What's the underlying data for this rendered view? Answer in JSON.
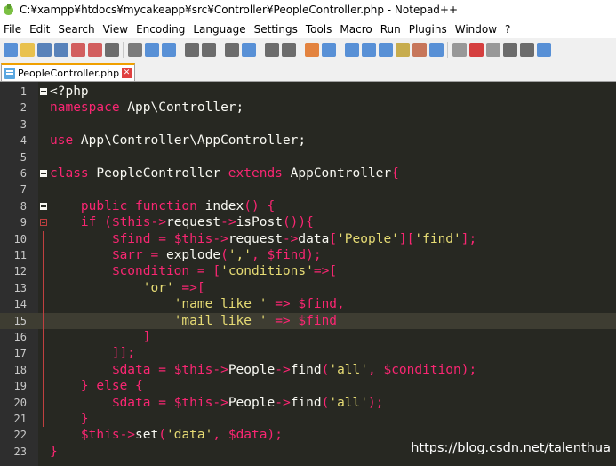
{
  "window": {
    "title": "C:¥xampp¥htdocs¥mycakeapp¥src¥Controller¥PeopleController.php - Notepad++"
  },
  "menu": [
    "File",
    "Edit",
    "Search",
    "View",
    "Encoding",
    "Language",
    "Settings",
    "Tools",
    "Macro",
    "Run",
    "Plugins",
    "Window",
    "?"
  ],
  "toolbar": {
    "icons": [
      "new-file-icon",
      "open-file-icon",
      "save-icon",
      "save-all-icon",
      "close-icon",
      "close-all-icon",
      "print-icon",
      "cut-icon",
      "copy-icon",
      "paste-icon",
      "undo-icon",
      "redo-icon",
      "find-icon",
      "replace-icon",
      "zoom-in-icon",
      "zoom-out-icon",
      "sync-v-icon",
      "sync-h-icon",
      "word-wrap-icon",
      "show-all-chars-icon",
      "indent-guide-icon",
      "doc-map-icon",
      "function-list-icon",
      "folder-workspace-icon",
      "monitoring-icon",
      "record-macro-icon",
      "stop-record-icon",
      "play-macro-icon",
      "run-macro-multiple-icon",
      "save-macro-icon"
    ]
  },
  "tab": {
    "label": "PeopleController.php"
  },
  "colors": {
    "background": "#272822",
    "keyword": "#f92672",
    "string": "#e6db74",
    "default": "#f8f8f2",
    "gutter": "#2e2e2e",
    "fold_red": "#c04040"
  },
  "editor": {
    "current_line": 15,
    "lines": [
      {
        "n": "1",
        "tokens": [
          [
            "op",
            "<?php"
          ]
        ]
      },
      {
        "n": "2",
        "tokens": [
          [
            "kw",
            "namespace"
          ],
          [
            "va",
            " App\\Controller;"
          ]
        ]
      },
      {
        "n": "3",
        "tokens": []
      },
      {
        "n": "4",
        "tokens": [
          [
            "kw",
            "use"
          ],
          [
            "va",
            " App\\Controller\\AppController;"
          ]
        ]
      },
      {
        "n": "5",
        "tokens": []
      },
      {
        "n": "6",
        "tokens": [
          [
            "kw",
            "class"
          ],
          [
            "va",
            " PeopleController "
          ],
          [
            "kw",
            "extends"
          ],
          [
            "va",
            " AppController"
          ],
          [
            "kw",
            "{"
          ]
        ]
      },
      {
        "n": "7",
        "tokens": []
      },
      {
        "n": "8",
        "tokens": [
          [
            "va",
            "    "
          ],
          [
            "kw",
            "public"
          ],
          [
            "va",
            " "
          ],
          [
            "kw",
            "function"
          ],
          [
            "va",
            " index"
          ],
          [
            "kw",
            "()"
          ],
          [
            "va",
            " "
          ],
          [
            "kw",
            "{"
          ]
        ]
      },
      {
        "n": "9",
        "tokens": [
          [
            "va",
            "    "
          ],
          [
            "kw",
            "if"
          ],
          [
            "va",
            " "
          ],
          [
            "kw",
            "("
          ],
          [
            "kw",
            "$this"
          ],
          [
            "kw",
            "->"
          ],
          [
            "va",
            "request"
          ],
          [
            "kw",
            "->"
          ],
          [
            "va",
            "isPost"
          ],
          [
            "kw",
            "()){"
          ]
        ]
      },
      {
        "n": "10",
        "tokens": [
          [
            "va",
            "        "
          ],
          [
            "kw",
            "$find"
          ],
          [
            "va",
            " "
          ],
          [
            "kw",
            "="
          ],
          [
            "va",
            " "
          ],
          [
            "kw",
            "$this"
          ],
          [
            "kw",
            "->"
          ],
          [
            "va",
            "request"
          ],
          [
            "kw",
            "->"
          ],
          [
            "va",
            "data"
          ],
          [
            "kw",
            "["
          ],
          [
            "st",
            "'People'"
          ],
          [
            "kw",
            "]["
          ],
          [
            "st",
            "'find'"
          ],
          [
            "kw",
            "];"
          ]
        ]
      },
      {
        "n": "11",
        "tokens": [
          [
            "va",
            "        "
          ],
          [
            "kw",
            "$arr"
          ],
          [
            "va",
            " "
          ],
          [
            "kw",
            "="
          ],
          [
            "va",
            " explode"
          ],
          [
            "kw",
            "("
          ],
          [
            "st",
            "','"
          ],
          [
            "kw",
            ","
          ],
          [
            "va",
            " "
          ],
          [
            "kw",
            "$find"
          ],
          [
            "kw",
            ");"
          ]
        ]
      },
      {
        "n": "12",
        "tokens": [
          [
            "va",
            "        "
          ],
          [
            "kw",
            "$condition"
          ],
          [
            "va",
            " "
          ],
          [
            "kw",
            "="
          ],
          [
            "va",
            " "
          ],
          [
            "kw",
            "["
          ],
          [
            "st",
            "'conditions'"
          ],
          [
            "kw",
            "=>["
          ]
        ]
      },
      {
        "n": "13",
        "tokens": [
          [
            "va",
            "            "
          ],
          [
            "st",
            "'or'"
          ],
          [
            "va",
            " "
          ],
          [
            "kw",
            "=>["
          ]
        ]
      },
      {
        "n": "14",
        "tokens": [
          [
            "va",
            "                "
          ],
          [
            "st",
            "'name like '"
          ],
          [
            "va",
            " "
          ],
          [
            "kw",
            "=>"
          ],
          [
            "va",
            " "
          ],
          [
            "kw",
            "$find"
          ],
          [
            "kw",
            ","
          ]
        ]
      },
      {
        "n": "15",
        "tokens": [
          [
            "va",
            "                "
          ],
          [
            "st",
            "'mail like '"
          ],
          [
            "va",
            " "
          ],
          [
            "kw",
            "=>"
          ],
          [
            "va",
            " "
          ],
          [
            "kw",
            "$find"
          ]
        ]
      },
      {
        "n": "16",
        "tokens": [
          [
            "va",
            "            "
          ],
          [
            "kw",
            "]"
          ]
        ]
      },
      {
        "n": "17",
        "tokens": [
          [
            "va",
            "        "
          ],
          [
            "kw",
            "]];"
          ]
        ]
      },
      {
        "n": "18",
        "tokens": [
          [
            "va",
            "        "
          ],
          [
            "kw",
            "$data"
          ],
          [
            "va",
            " "
          ],
          [
            "kw",
            "="
          ],
          [
            "va",
            " "
          ],
          [
            "kw",
            "$this"
          ],
          [
            "kw",
            "->"
          ],
          [
            "va",
            "People"
          ],
          [
            "kw",
            "->"
          ],
          [
            "va",
            "find"
          ],
          [
            "kw",
            "("
          ],
          [
            "st",
            "'all'"
          ],
          [
            "kw",
            ","
          ],
          [
            "va",
            " "
          ],
          [
            "kw",
            "$condition"
          ],
          [
            "kw",
            ");"
          ]
        ]
      },
      {
        "n": "19",
        "tokens": [
          [
            "va",
            "    "
          ],
          [
            "kw",
            "}"
          ],
          [
            "va",
            " "
          ],
          [
            "kw",
            "else"
          ],
          [
            "va",
            " "
          ],
          [
            "kw",
            "{"
          ]
        ]
      },
      {
        "n": "20",
        "tokens": [
          [
            "va",
            "        "
          ],
          [
            "kw",
            "$data"
          ],
          [
            "va",
            " "
          ],
          [
            "kw",
            "="
          ],
          [
            "va",
            " "
          ],
          [
            "kw",
            "$this"
          ],
          [
            "kw",
            "->"
          ],
          [
            "va",
            "People"
          ],
          [
            "kw",
            "->"
          ],
          [
            "va",
            "find"
          ],
          [
            "kw",
            "("
          ],
          [
            "st",
            "'all'"
          ],
          [
            "kw",
            ");"
          ]
        ]
      },
      {
        "n": "21",
        "tokens": [
          [
            "va",
            "    "
          ],
          [
            "kw",
            "}"
          ]
        ]
      },
      {
        "n": "22",
        "tokens": [
          [
            "va",
            "    "
          ],
          [
            "kw",
            "$this"
          ],
          [
            "kw",
            "->"
          ],
          [
            "va",
            "set"
          ],
          [
            "kw",
            "("
          ],
          [
            "st",
            "'data'"
          ],
          [
            "kw",
            ","
          ],
          [
            "va",
            " "
          ],
          [
            "kw",
            "$data"
          ],
          [
            "kw",
            ");"
          ]
        ]
      },
      {
        "n": "23",
        "tokens": [
          [
            "kw",
            "}"
          ]
        ]
      }
    ]
  },
  "watermark": "https://blog.csdn.net/talenthua"
}
